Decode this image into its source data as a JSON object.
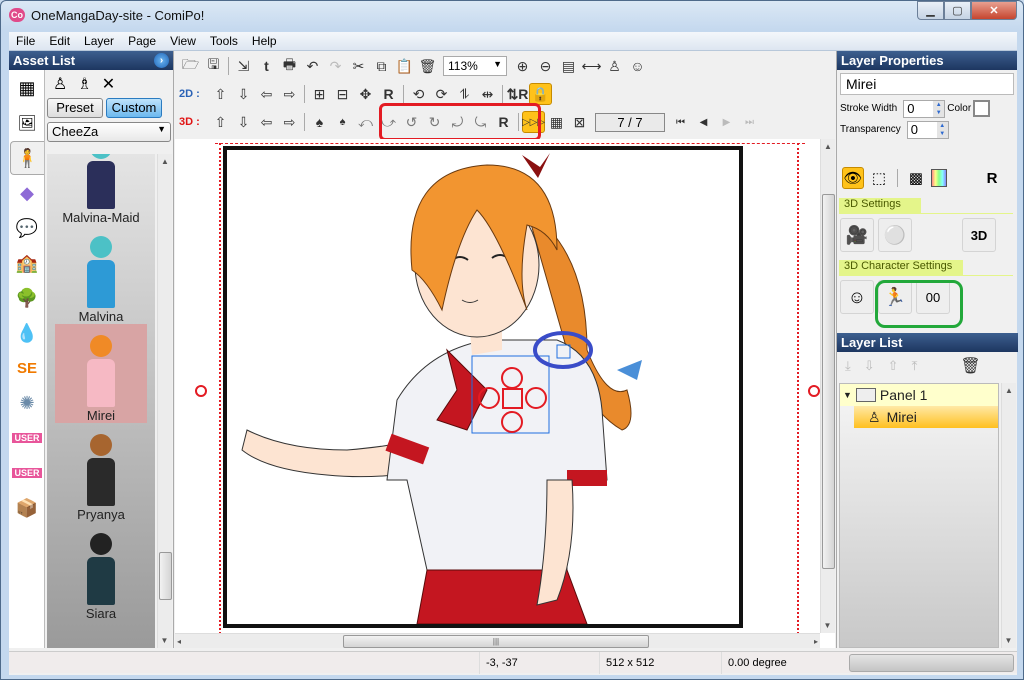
{
  "window": {
    "title": "OneMangaDay-site - ComiPo!",
    "app_icon": "comipo-logo-icon",
    "controls": [
      "minimize",
      "maximize",
      "close"
    ]
  },
  "menu": [
    "File",
    "Edit",
    "Layer",
    "Page",
    "View",
    "Tools",
    "Help"
  ],
  "asset_list": {
    "title": "Asset List",
    "tabs": [
      {
        "icon": "panel-layout-icon"
      },
      {
        "icon": "panel-image-icon"
      },
      {
        "icon": "character-icon",
        "selected": true
      },
      {
        "icon": "3d-object-icon"
      },
      {
        "icon": "speech-balloon-icon"
      },
      {
        "icon": "background-icon"
      },
      {
        "icon": "tree-icon"
      },
      {
        "icon": "effect-drop-icon"
      },
      {
        "icon": "sound-effect-icon",
        "text": "SE"
      },
      {
        "icon": "burst-effect-icon"
      },
      {
        "icon": "user-background-icon",
        "text": "USER"
      },
      {
        "icon": "user-3d-object-icon",
        "text": "USER"
      },
      {
        "icon": "character-box-icon"
      }
    ],
    "filter_buttons": {
      "preset": "Preset",
      "custom": "Custom",
      "active": "Custom"
    },
    "dropdown_value": "CheeZa",
    "characters": [
      {
        "name": "Malvina-Maid",
        "hair": "#4cc1c6",
        "body": "#2b2f5a"
      },
      {
        "name": "Malvina",
        "hair": "#4cc1c6",
        "body": "#2d9ad6"
      },
      {
        "name": "Mirei",
        "hair": "#f08a26",
        "body": "#f6b9c4",
        "selected": true
      },
      {
        "name": "Pryanya",
        "hair": "#a7652f",
        "body": "#2a2a2a"
      },
      {
        "name": "Siara",
        "hair": "#222",
        "body": "#1f3a44"
      }
    ]
  },
  "toolbar": {
    "row1": [
      "open-icon",
      "save-icon",
      "export-icon",
      "twitter-icon",
      "print-icon",
      "undo-icon",
      "redo-icon",
      "cut-icon",
      "copy-icon",
      "paste-icon",
      "delete-icon"
    ],
    "zoom_value": "113%",
    "row1_right": [
      "zoom-in-icon",
      "zoom-out-icon",
      "fit-page-icon",
      "fit-width-icon",
      "new-character-icon",
      "mascot-icon"
    ],
    "label_2d": "2D :",
    "label_3d": "3D :",
    "page_indicator": "7 / 7"
  },
  "layer_properties": {
    "title": "Layer Properties",
    "name": "Mirei",
    "stroke_width_label": "Stroke Width",
    "stroke_width": "0",
    "color_label": "Color",
    "transparency_label": "Transparency",
    "transparency": "0",
    "section_3d": "3D Settings",
    "section_3d_char": "3D Character Settings"
  },
  "layer_list": {
    "title": "Layer List",
    "items": [
      {
        "label": "Panel 1",
        "type": "panel",
        "expanded": true
      },
      {
        "label": "Mirei",
        "type": "character",
        "selected": true
      }
    ]
  },
  "status": {
    "coords": "-3, -37",
    "size": "512 x 512",
    "angle": "0.00 degree"
  },
  "colors": {
    "accent_3d": "#e01414",
    "accent_2d": "#2a62b6",
    "highlight_red": "#e31b23",
    "highlight_green": "#22a83a",
    "highlight_blue": "#3a4cc8",
    "selected_layer": "#ffc020"
  }
}
